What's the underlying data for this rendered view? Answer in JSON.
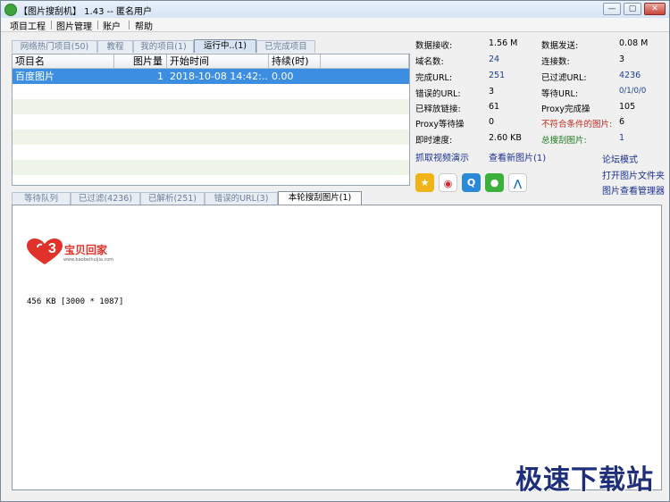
{
  "title": "【图片搜刮机】 1.43 -- 匿名用户",
  "window_buttons": {
    "minimize": "—",
    "maximize": "▢",
    "close": "✕"
  },
  "menu": [
    "项目工程",
    "图片管理",
    "账户",
    "帮助"
  ],
  "top_tabs": [
    {
      "label": "网络热门项目(50)"
    },
    {
      "label": "教程"
    },
    {
      "label": "我的项目(1)"
    },
    {
      "label": "运行中..(1)"
    },
    {
      "label": "已完成项目"
    }
  ],
  "table": {
    "headers": [
      "项目名",
      "图片量",
      "开始时间",
      "持续(时)"
    ],
    "rows": [
      {
        "name": "百度图片",
        "count": "1",
        "start": "2018-10-08 14:42:...",
        "duration": "0.00"
      }
    ]
  },
  "stats": [
    {
      "label": "数据接收:",
      "value": "1.56 M"
    },
    {
      "label": "数据发送:",
      "value": "0.08 M"
    },
    {
      "label": "域名数:",
      "value": "24"
    },
    {
      "label": "连接数:",
      "value": "3"
    },
    {
      "label": "完成URL:",
      "value": "251"
    },
    {
      "label": "已过滤URL:",
      "value": "4236"
    },
    {
      "label": "错误的URL:",
      "value": "3"
    },
    {
      "label": "等待URL:",
      "value": "0/1/0/0"
    },
    {
      "label": "已释放链接:",
      "value": "61"
    },
    {
      "label": "Proxy完成操",
      "value": "105"
    },
    {
      "label": "Proxy等待操",
      "value": "0"
    },
    {
      "label": "不符合条件的图片:",
      "value": "6"
    },
    {
      "label": "即时速度:",
      "value": "2.60 KB"
    },
    {
      "label": "总搜刮图片:",
      "value": "1"
    }
  ],
  "links": {
    "video_demo": "抓取视频演示",
    "view_new": "查看新图片(1)",
    "forum": "论坛模式",
    "open_folder": "打开图片文件夹",
    "image_manager": "图片查看管理器"
  },
  "share_icons": [
    "qzone-icon",
    "weibo-icon",
    "qq-icon",
    "wechat-icon",
    "tencent-weibo-icon"
  ],
  "bottom_tabs": [
    {
      "label": "等待队列"
    },
    {
      "label": "已过滤(4236)"
    },
    {
      "label": "已解析(251)"
    },
    {
      "label": "错误的URL(3)"
    },
    {
      "label": "本轮搜刮图片(1)"
    }
  ],
  "preview": {
    "logo_text": "宝贝回家",
    "logo_url": "www.baobeihuijia.com",
    "logo_number": "3",
    "info": "456 KB [3000 * 1087]"
  },
  "watermark": "极速下载站",
  "colors": {
    "selection": "#3c8fe0",
    "link": "#1a2f8f",
    "red_label": "#c0281e",
    "green_label": "#1c7a1c",
    "logo_red": "#e0322b"
  }
}
